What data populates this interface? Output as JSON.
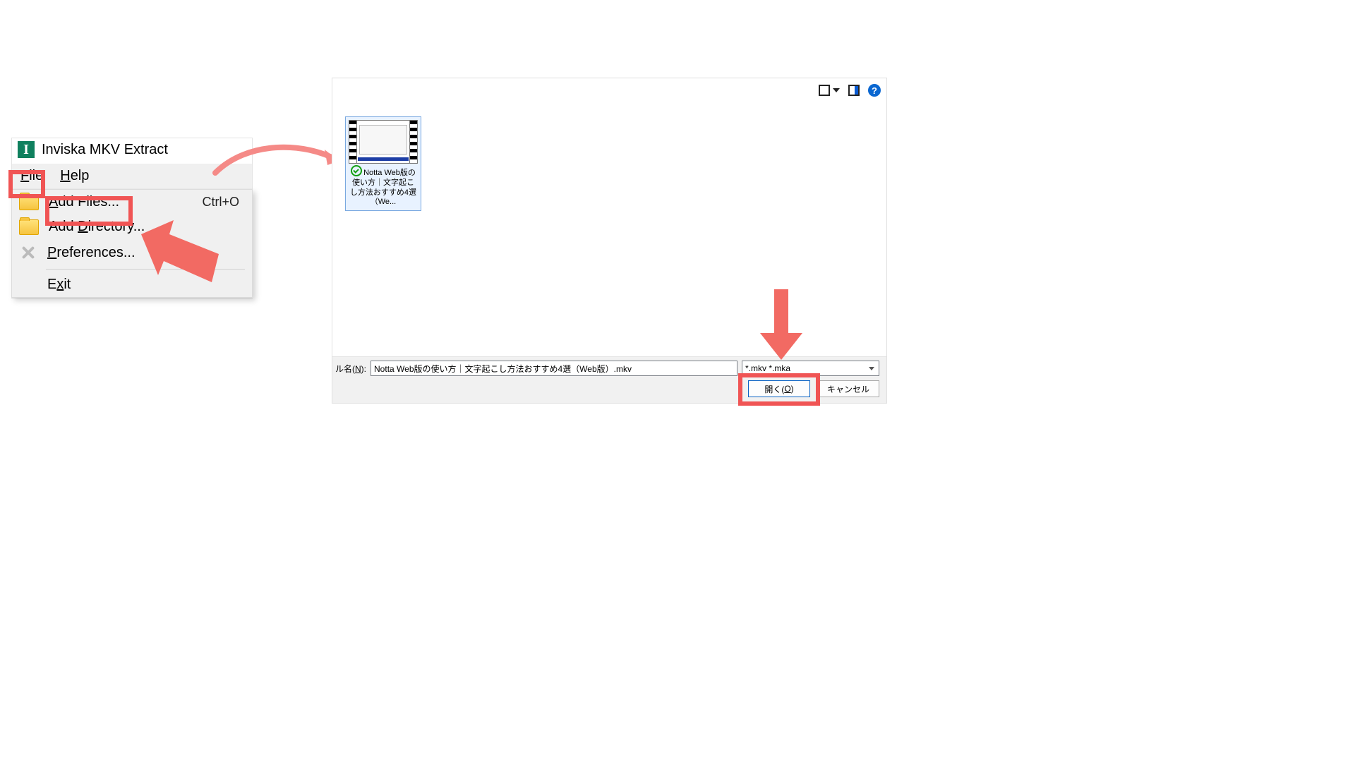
{
  "app": {
    "title": "Inviska MKV Extract",
    "icon_letter": "I"
  },
  "menubar": {
    "file": "File",
    "help": "Help"
  },
  "file_menu": {
    "add_files": {
      "label": "Add Files...",
      "shortcut": "Ctrl+O"
    },
    "add_directory": {
      "label": "Add Directory..."
    },
    "preferences": {
      "label": "Preferences..."
    },
    "exit": {
      "label": "Exit"
    }
  },
  "dialog": {
    "file_tile_name": "Notta Web版の使い方｜文字起こし方法おすすめ4選（We...",
    "filename_label_prefix": "ル名(",
    "filename_label_hotkey": "N",
    "filename_label_suffix": "):",
    "filename_value": "Notta Web版の使い方｜文字起こし方法おすすめ4選（Web版）.mkv",
    "filter_value": "*.mkv *.mka",
    "open_label_prefix": "開く(",
    "open_label_hotkey": "O",
    "open_label_suffix": ")",
    "cancel_label": "キャンセル"
  },
  "toolbar": {
    "help_symbol": "?"
  }
}
